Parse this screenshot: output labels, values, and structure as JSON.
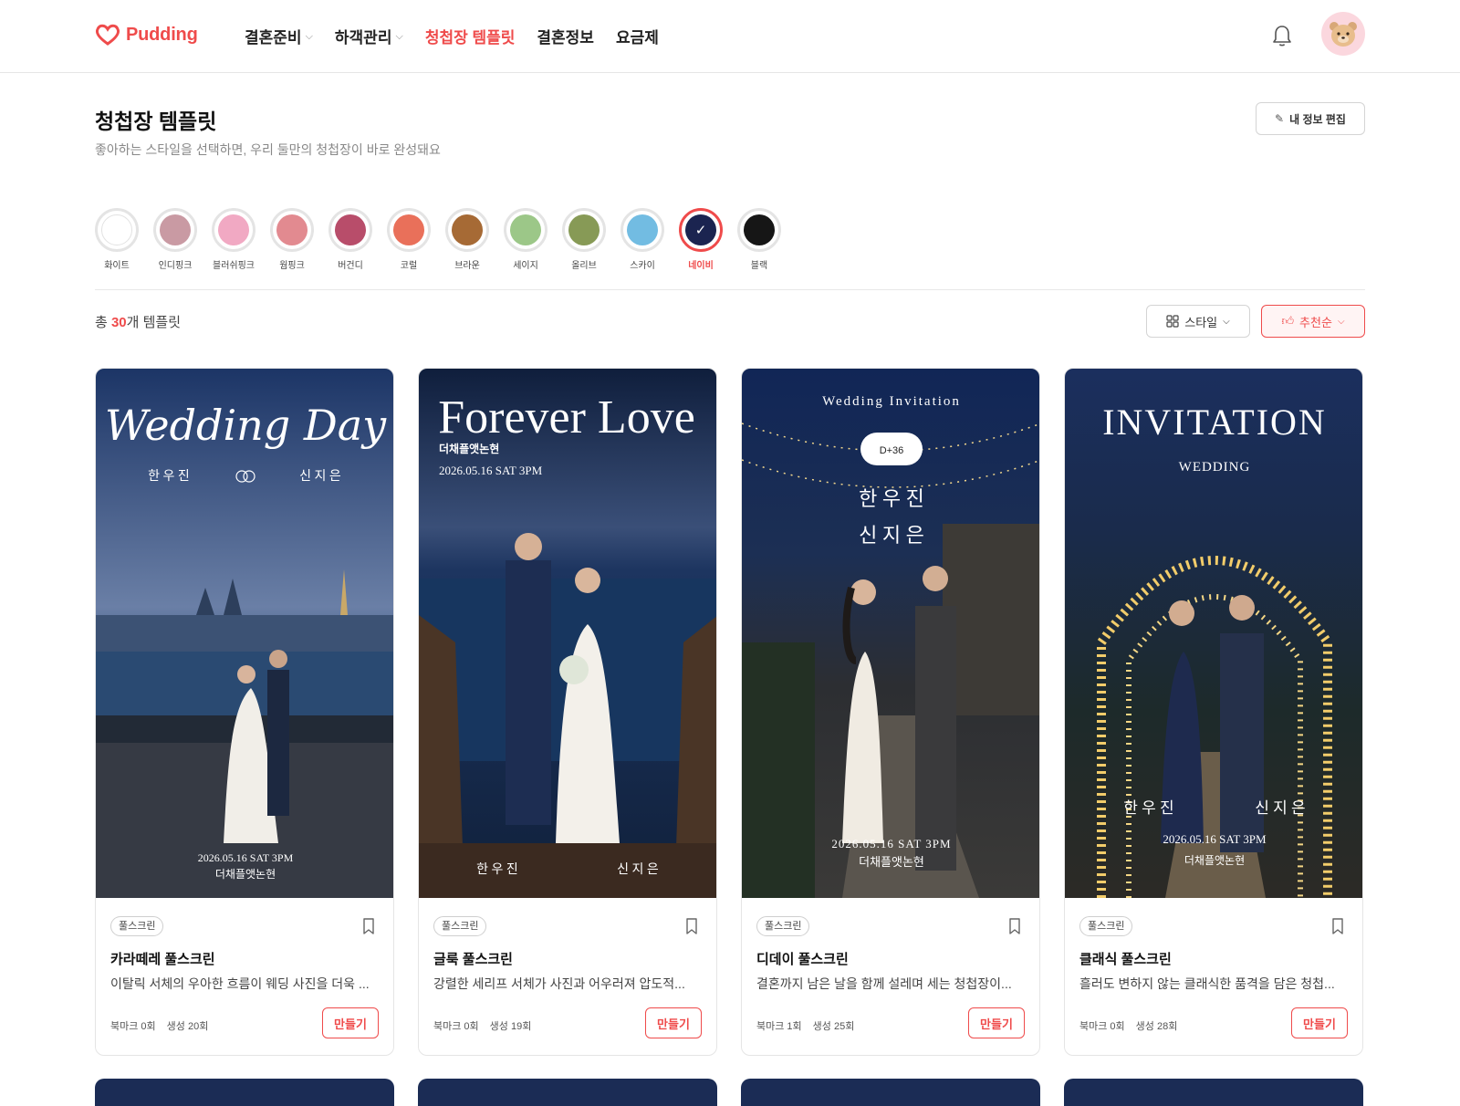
{
  "header": {
    "logo_text": "Pudding",
    "nav": [
      {
        "label": "결혼준비",
        "has_dropdown": true,
        "active": false
      },
      {
        "label": "하객관리",
        "has_dropdown": true,
        "active": false
      },
      {
        "label": "청첩장 템플릿",
        "has_dropdown": false,
        "active": true
      },
      {
        "label": "결혼정보",
        "has_dropdown": false,
        "active": false
      },
      {
        "label": "요금제",
        "has_dropdown": false,
        "active": false
      }
    ]
  },
  "page": {
    "title": "청첩장 템플릿",
    "subtitle": "좋아하는 스타일을 선택하면, 우리 둘만의 청첩장이 바로 완성돼요",
    "edit_button": "내 정보 편집"
  },
  "colors": [
    {
      "label": "화이트",
      "hex": "#ffffff",
      "selected": false
    },
    {
      "label": "인디핑크",
      "hex": "#c99aa3",
      "selected": false
    },
    {
      "label": "블러쉬핑크",
      "hex": "#f1a9c3",
      "selected": false
    },
    {
      "label": "웜핑크",
      "hex": "#e28a90",
      "selected": false
    },
    {
      "label": "버건디",
      "hex": "#b84d6a",
      "selected": false
    },
    {
      "label": "코럴",
      "hex": "#e9705a",
      "selected": false
    },
    {
      "label": "브라운",
      "hex": "#a66a35",
      "selected": false
    },
    {
      "label": "세이지",
      "hex": "#9cc788",
      "selected": false
    },
    {
      "label": "올리브",
      "hex": "#879a56",
      "selected": false
    },
    {
      "label": "스카이",
      "hex": "#72bce2",
      "selected": false
    },
    {
      "label": "네이비",
      "hex": "#1b2450",
      "selected": true
    },
    {
      "label": "블랙",
      "hex": "#161616",
      "selected": false
    }
  ],
  "list": {
    "total_prefix": "총 ",
    "total_count": "30",
    "total_suffix": "개 템플릿",
    "style_filter": "스타일",
    "sort": "추천순"
  },
  "templates": [
    {
      "tag": "풀스크린",
      "title": "카라떼레 풀스크린",
      "desc": "이탈릭 서체의 우아한 흐름이 웨딩 사진을 더욱 ...",
      "bookmarks": "북마크 0회",
      "created": "생성 20회",
      "button": "만들기",
      "thumb": {
        "headline": "Wedding Day",
        "groom": "한 우 진",
        "bride": "신 지 은",
        "date": "2026.05.16 SAT 3PM",
        "venue": "더채플앳논현"
      }
    },
    {
      "tag": "풀스크린",
      "title": "글룩 풀스크린",
      "desc": "강렬한 세리프 서체가 사진과 어우러져 압도적...",
      "bookmarks": "북마크 0회",
      "created": "생성 19회",
      "button": "만들기",
      "thumb": {
        "headline": "Forever Love",
        "venue": "더채플앳논현",
        "date": "2026.05.16 SAT 3PM",
        "groom": "한 우 진",
        "bride": "신 지 은"
      }
    },
    {
      "tag": "풀스크린",
      "title": "디데이 풀스크린",
      "desc": "결혼까지 남은 날을 함께 설레며 세는 청첩장이...",
      "bookmarks": "북마크 1회",
      "created": "생성 25회",
      "button": "만들기",
      "thumb": {
        "headline": "Wedding Invitation",
        "dday": "D+36",
        "groom": "한 우 진",
        "bride": "신 지 은",
        "date": "2026.05.16 SAT 3PM",
        "venue": "더채플앳논현"
      }
    },
    {
      "tag": "풀스크린",
      "title": "클래식 풀스크린",
      "desc": "흘러도 변하지 않는 클래식한 품격을 담은 청첩...",
      "bookmarks": "북마크 0회",
      "created": "생성 28회",
      "button": "만들기",
      "thumb": {
        "headline": "INVITATION",
        "subhead": "WEDDING",
        "groom": "한 우 진",
        "bride": "신 지 은",
        "date": "2026.05.16 SAT 3PM",
        "venue": "더채플앳논현"
      }
    }
  ]
}
